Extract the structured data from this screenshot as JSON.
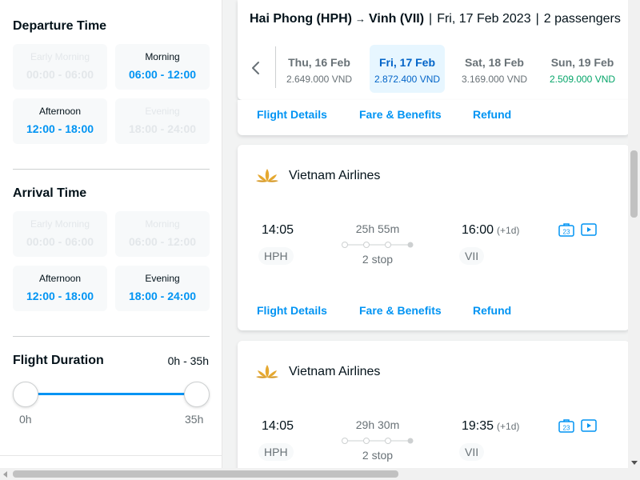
{
  "filters": {
    "departure": {
      "title": "Departure Time",
      "slots": [
        {
          "label": "Early Morning",
          "range": "00:00 - 06:00",
          "enabled": false
        },
        {
          "label": "Morning",
          "range": "06:00 - 12:00",
          "enabled": true
        },
        {
          "label": "Afternoon",
          "range": "12:00 - 18:00",
          "enabled": true
        },
        {
          "label": "Evening",
          "range": "18:00 - 24:00",
          "enabled": false
        }
      ]
    },
    "arrival": {
      "title": "Arrival Time",
      "slots": [
        {
          "label": "Early Morning",
          "range": "00:00 - 06:00",
          "enabled": false
        },
        {
          "label": "Morning",
          "range": "06:00 - 12:00",
          "enabled": false
        },
        {
          "label": "Afternoon",
          "range": "12:00 - 18:00",
          "enabled": true
        },
        {
          "label": "Evening",
          "range": "18:00 - 24:00",
          "enabled": true
        }
      ]
    },
    "duration": {
      "title": "Flight Duration",
      "range_text": "0h - 35h",
      "min_label": "0h",
      "max_label": "35h",
      "selected_min_fraction": 0,
      "selected_max_fraction": 1
    }
  },
  "header": {
    "origin": "Hai Phong (HPH)",
    "arrow": "→",
    "destination": "Vinh (VII)",
    "separator": "|",
    "date": "Fri, 17 Feb 2023",
    "passengers": "2 passengers",
    "dates": [
      {
        "day": "Thu, 16 Feb",
        "price": "2.649.000 VND",
        "state": "normal"
      },
      {
        "day": "Fri, 17 Feb",
        "price": "2.872.400 VND",
        "state": "active"
      },
      {
        "day": "Sat, 18 Feb",
        "price": "3.169.000 VND",
        "state": "normal"
      },
      {
        "day": "Sun, 19 Feb",
        "price": "2.509.000 VND",
        "state": "cheapest"
      }
    ]
  },
  "prev_card_links": {
    "details": "Flight Details",
    "fare": "Fare & Benefits",
    "refund": "Refund"
  },
  "flights": [
    {
      "airline": "Vietnam Airlines",
      "dep_time": "14:05",
      "dep_code": "HPH",
      "duration": "25h 55m",
      "stops": "2 stop",
      "arr_time": "16:00",
      "arr_day_offset": "(+1d)",
      "arr_code": "VII",
      "links": {
        "details": "Flight Details",
        "fare": "Fare & Benefits",
        "refund": "Refund"
      }
    },
    {
      "airline": "Vietnam Airlines",
      "dep_time": "14:05",
      "dep_code": "HPH",
      "duration": "29h 30m",
      "stops": "2 stop",
      "arr_time": "19:35",
      "arr_day_offset": "(+1d)",
      "arr_code": "VII"
    }
  ],
  "baggage_badge": "23",
  "colors": {
    "accent": "#0194f3",
    "active_date_bg": "#e7f6ff",
    "cheapest_price": "#05a569",
    "logo_gold": "#e5a830"
  }
}
